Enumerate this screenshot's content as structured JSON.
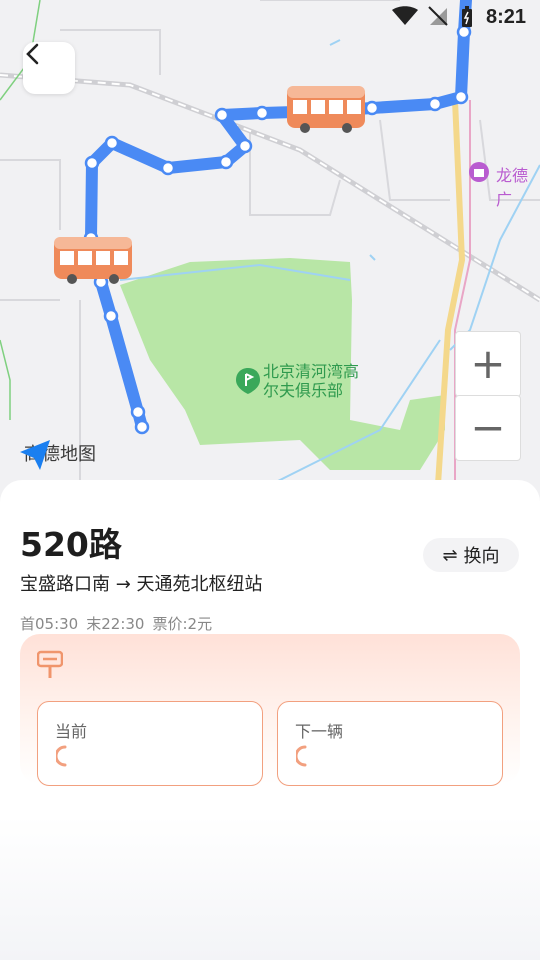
{
  "status_bar": {
    "time": "8:21"
  },
  "map": {
    "poi_golf_line1": "北京清河湾高",
    "poi_golf_line2": "尔夫俱乐部",
    "poi_right": "龙德广",
    "logo_text": "高德地图",
    "zoom_in_symbol": "+",
    "zoom_out_symbol": "−",
    "route_color": "#4a8af4"
  },
  "route": {
    "name": "520路",
    "direction": "宝盛路口南 → 天通苑北枢纽站",
    "first_bus": "首05:30",
    "last_bus": "末22:30",
    "fare": "票价:2元",
    "switch_label": "换向",
    "switch_icon": "⇌"
  },
  "realtime": {
    "current_label": "当前",
    "next_label": "下一辆",
    "accent": "#f2a07f"
  }
}
